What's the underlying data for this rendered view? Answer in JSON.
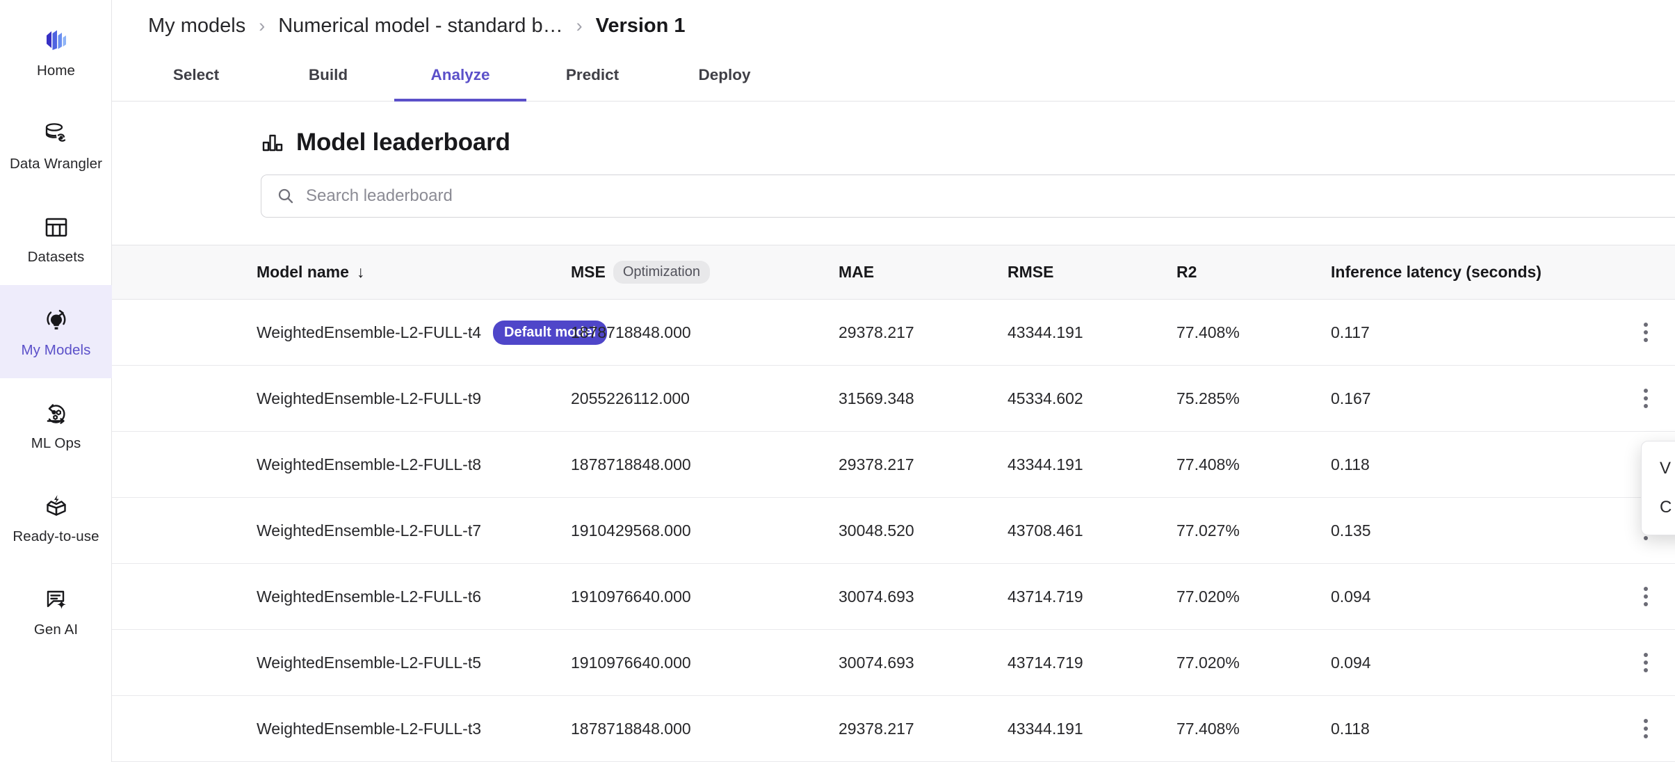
{
  "sidebar": {
    "items": [
      {
        "label": "Home",
        "icon": "home-logo-icon",
        "active": false
      },
      {
        "label": "Data Wrangler",
        "icon": "database-sync-icon",
        "active": false
      },
      {
        "label": "Datasets",
        "icon": "table-grid-icon",
        "active": false
      },
      {
        "label": "My Models",
        "icon": "model-bulb-icon",
        "active": true
      },
      {
        "label": "ML Ops",
        "icon": "mlops-cycle-icon",
        "active": false
      },
      {
        "label": "Ready-to-use",
        "icon": "open-box-bolt-icon",
        "active": false
      },
      {
        "label": "Gen AI",
        "icon": "chat-sparkle-icon",
        "active": false
      }
    ]
  },
  "breadcrumb": {
    "items": [
      {
        "label": "My models",
        "current": false
      },
      {
        "label": "Numerical model - standard b…",
        "current": false
      },
      {
        "label": "Version 1",
        "current": true
      }
    ],
    "separator": "›"
  },
  "tabs": [
    {
      "label": "Select",
      "active": false
    },
    {
      "label": "Build",
      "active": false
    },
    {
      "label": "Analyze",
      "active": true
    },
    {
      "label": "Predict",
      "active": false
    },
    {
      "label": "Deploy",
      "active": false
    }
  ],
  "leaderboard": {
    "title": "Model leaderboard",
    "title_icon": "bar-chart-icon",
    "search": {
      "placeholder": "Search leaderboard",
      "value": "",
      "icon": "search-icon"
    },
    "columns": [
      {
        "key": "name",
        "label": "Model name",
        "sort_icon": "↓",
        "chip": null
      },
      {
        "key": "mse",
        "label": "MSE",
        "sort_icon": null,
        "chip": "Optimization"
      },
      {
        "key": "mae",
        "label": "MAE",
        "sort_icon": null,
        "chip": null
      },
      {
        "key": "rmse",
        "label": "RMSE",
        "sort_icon": null,
        "chip": null
      },
      {
        "key": "r2",
        "label": "R2",
        "sort_icon": null,
        "chip": null
      },
      {
        "key": "latency",
        "label": "Inference latency (seconds)",
        "sort_icon": null,
        "chip": null
      }
    ],
    "badge_default_label": "Default model",
    "rows": [
      {
        "name": "WeightedEnsemble-L2-FULL-t4",
        "badge": "Default model",
        "mse": "1878718848.000",
        "mae": "29378.217",
        "rmse": "43344.191",
        "r2": "77.408%",
        "latency": "0.117"
      },
      {
        "name": "WeightedEnsemble-L2-FULL-t9",
        "badge": null,
        "mse": "2055226112.000",
        "mae": "31569.348",
        "rmse": "45334.602",
        "r2": "75.285%",
        "latency": "0.167"
      },
      {
        "name": "WeightedEnsemble-L2-FULL-t8",
        "badge": null,
        "mse": "1878718848.000",
        "mae": "29378.217",
        "rmse": "43344.191",
        "r2": "77.408%",
        "latency": "0.118"
      },
      {
        "name": "WeightedEnsemble-L2-FULL-t7",
        "badge": null,
        "mse": "1910429568.000",
        "mae": "30048.520",
        "rmse": "43708.461",
        "r2": "77.027%",
        "latency": "0.135"
      },
      {
        "name": "WeightedEnsemble-L2-FULL-t6",
        "badge": null,
        "mse": "1910976640.000",
        "mae": "30074.693",
        "rmse": "43714.719",
        "r2": "77.020%",
        "latency": "0.094"
      },
      {
        "name": "WeightedEnsemble-L2-FULL-t5",
        "badge": null,
        "mse": "1910976640.000",
        "mae": "30074.693",
        "rmse": "43714.719",
        "r2": "77.020%",
        "latency": "0.094"
      },
      {
        "name": "WeightedEnsemble-L2-FULL-t3",
        "badge": null,
        "mse": "1878718848.000",
        "mae": "29378.217",
        "rmse": "43344.191",
        "r2": "77.408%",
        "latency": "0.118"
      }
    ],
    "row_action_icon": "kebab-menu-icon"
  },
  "context_menu": {
    "open": true,
    "items": [
      {
        "label": "V"
      },
      {
        "label": "C"
      }
    ]
  },
  "colors": {
    "accent": "#5b50c9",
    "badge_bg": "#4f46c9",
    "active_nav_bg": "#eeecfb",
    "border": "#e4e4e7",
    "header_bg": "#f8f8f9"
  }
}
